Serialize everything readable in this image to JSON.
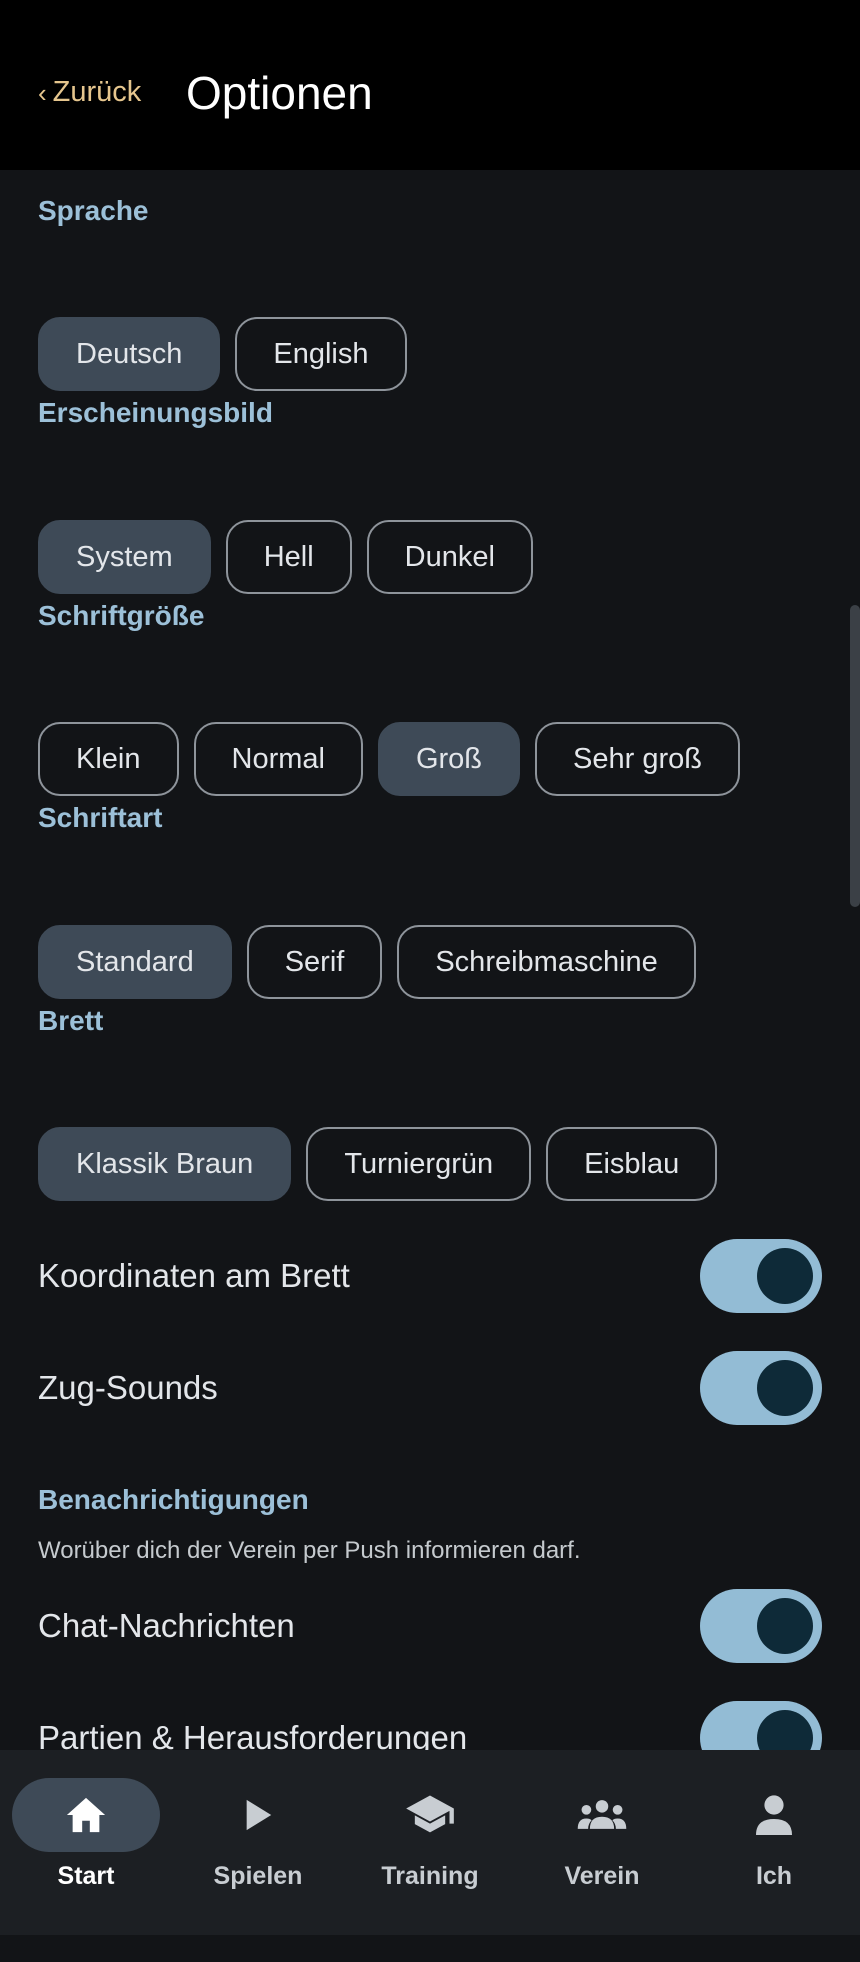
{
  "header": {
    "back_label": "Zurück",
    "title": "Optionen"
  },
  "sections": {
    "language": {
      "title": "Sprache",
      "options": [
        "Deutsch",
        "English"
      ],
      "selected": "Deutsch"
    },
    "appearance": {
      "title": "Erscheinungsbild",
      "options": [
        "System",
        "Hell",
        "Dunkel"
      ],
      "selected": "System"
    },
    "font_size": {
      "title": "Schriftgröße",
      "options": [
        "Klein",
        "Normal",
        "Groß",
        "Sehr groß"
      ],
      "selected": "Groß"
    },
    "font": {
      "title": "Schriftart",
      "options": [
        "Standard",
        "Serif",
        "Schreibmaschine"
      ],
      "selected": "Standard"
    },
    "board": {
      "title": "Brett",
      "options": [
        "Klassik Braun",
        "Turniergrün",
        "Eisblau"
      ],
      "selected": "Klassik Braun"
    }
  },
  "toggles": {
    "coordinates": {
      "label": "Koordinaten am Brett",
      "on": true
    },
    "sounds": {
      "label": "Zug-Sounds",
      "on": true
    }
  },
  "notifications": {
    "title": "Benachrichtigungen",
    "subtitle": "Worüber dich der Verein per Push informieren darf.",
    "chat": {
      "label": "Chat-Nachrichten",
      "on": true
    },
    "games": {
      "label": "Partien & Herausforderungen",
      "on": true
    }
  },
  "nav": {
    "items": [
      {
        "label": "Start",
        "icon": "home-icon",
        "active": true
      },
      {
        "label": "Spielen",
        "icon": "play-icon",
        "active": false
      },
      {
        "label": "Training",
        "icon": "school-icon",
        "active": false
      },
      {
        "label": "Verein",
        "icon": "group-icon",
        "active": false
      },
      {
        "label": "Ich",
        "icon": "person-icon",
        "active": false
      }
    ]
  },
  "colors": {
    "accent": "#93bcd5",
    "section_title": "#9cc0d8",
    "back_link": "#e6c68e",
    "chip_selected": "#3e4a57"
  }
}
